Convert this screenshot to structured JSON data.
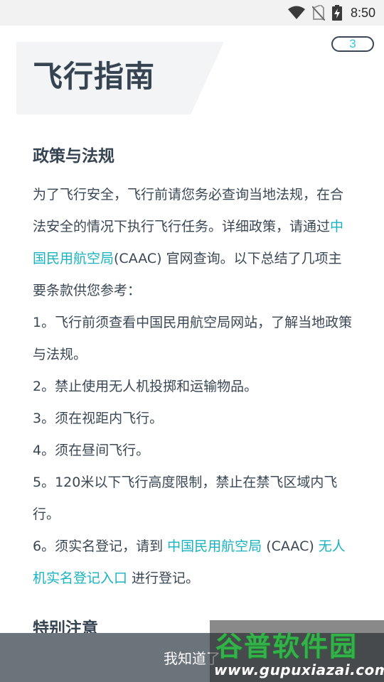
{
  "status_bar": {
    "time": "8:50"
  },
  "header": {
    "title": "飞行指南",
    "page_badge": "3"
  },
  "policy": {
    "heading": "政策与法规",
    "intro": {
      "part1": "为了飞行安全，飞行前请您务必查询当地法规，在合法安全的情况下执行飞行任务。详细政策，请通过",
      "link": "中国民用航空局",
      "part2": "(CAAC) 官网查询。以下总结了几项主要条款供您参考："
    },
    "rules": [
      "1。飞行前须查看中国民用航空局网站，了解当地政策与法规。",
      "2。禁止使用无人机投掷和运输物品。",
      "3。须在视距内飞行。",
      "4。须在昼间飞行。",
      "5。120米以下飞行高度限制，禁止在禁飞区域内飞行。"
    ],
    "rule6": {
      "prefix": "6。须实名登记，请到 ",
      "link1": "中国民用航空局",
      "middle": " (CAAC) ",
      "link2": "无人机实名登记入口",
      "suffix": " 进行登记。"
    }
  },
  "special": {
    "heading": "特别注意"
  },
  "footer": {
    "confirm_label": "我知道了"
  },
  "watermark": {
    "title": "谷普软件园",
    "url": "www.gupuxiazai.com"
  },
  "colors": {
    "link": "#19b3c0",
    "badge_text": "#33c9d6",
    "bottom_bar": "#6b737b"
  },
  "icons": [
    "wifi-icon",
    "no-sim-icon",
    "battery-charging-icon"
  ]
}
